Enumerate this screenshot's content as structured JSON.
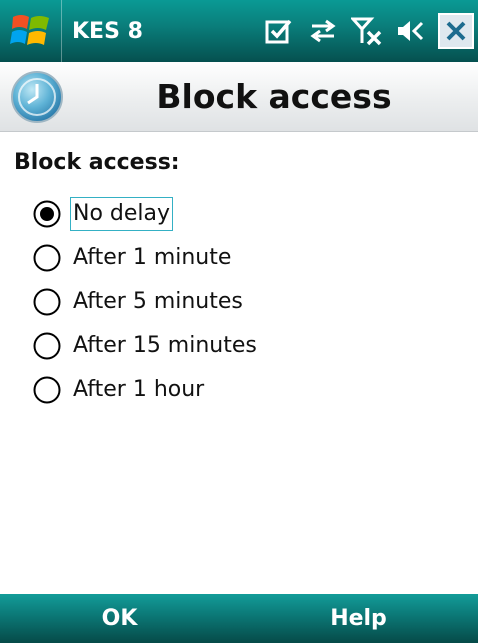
{
  "status_bar": {
    "app_title": "KES 8",
    "icons": [
      "windows-start-icon",
      "notification-check-icon",
      "sync-arrows-icon",
      "signal-off-icon",
      "volume-icon",
      "close-icon"
    ]
  },
  "title_bar": {
    "title": "Block access",
    "back_icon": "clock-back-icon"
  },
  "content": {
    "section_label": "Block access:",
    "options": [
      {
        "label": "No delay",
        "selected": true
      },
      {
        "label": "After 1 minute",
        "selected": false
      },
      {
        "label": "After 5 minutes",
        "selected": false
      },
      {
        "label": "After 15 minutes",
        "selected": false
      },
      {
        "label": "After 1 hour",
        "selected": false
      }
    ]
  },
  "softkeys": {
    "left": "OK",
    "right": "Help"
  },
  "colors": {
    "status_bar": "#0a7f7c",
    "softkey_bar": "#0b7775",
    "focus_border": "#34b0c4"
  }
}
